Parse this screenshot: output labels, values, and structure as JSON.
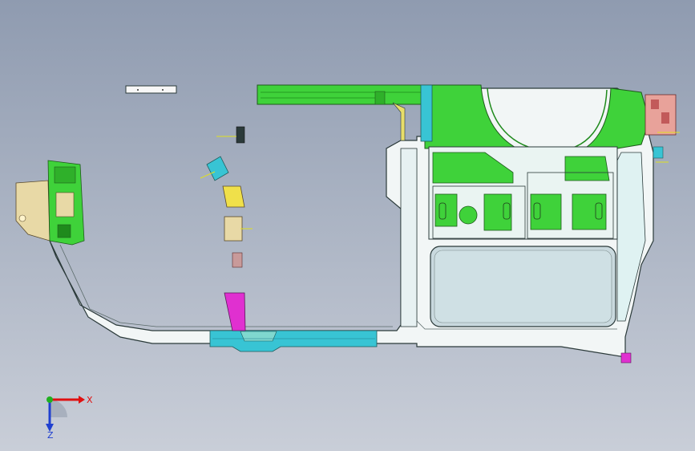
{
  "viewport": {
    "background_top": "#8f9bb0",
    "background_bottom": "#c9ced8"
  },
  "colors": {
    "green_part": "#3fd23a",
    "green_dark": "#1f8a1c",
    "cyan_part": "#38c4d4",
    "teal_part": "#7fd8cf",
    "frame_fill": "#f2f6f6",
    "frame_edge": "#2b3a3a",
    "yellow_part": "#f0e04a",
    "magenta_part": "#e030d0",
    "tan_part": "#e8d9a6",
    "salmon_part": "#e8a29a",
    "x_axis": "#e01010",
    "y_axis": "#20b020",
    "z_axis": "#2040d0"
  },
  "triad": {
    "x_label": "X",
    "z_label": "Z",
    "icon": "coordinate-triad-icon"
  }
}
